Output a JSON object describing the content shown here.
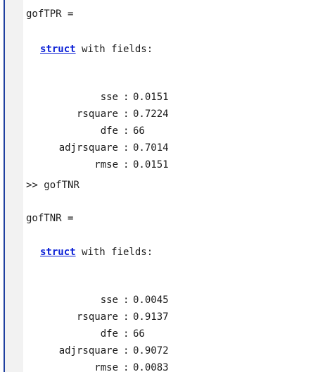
{
  "console": {
    "block1": {
      "var_header": "gofTPR =",
      "struct_keyword": "struct",
      "struct_suffix": " with fields:",
      "fields": [
        {
          "name": "sse",
          "value": "0.0151"
        },
        {
          "name": "rsquare",
          "value": "0.7224"
        },
        {
          "name": "dfe",
          "value": "66"
        },
        {
          "name": "adjrsquare",
          "value": "0.7014"
        },
        {
          "name": "rmse",
          "value": "0.0151"
        }
      ]
    },
    "command": {
      "prompt": ">>",
      "text": "gofTNR"
    },
    "block2": {
      "var_header": "gofTNR =",
      "struct_keyword": "struct",
      "struct_suffix": " with fields:",
      "fields": [
        {
          "name": "sse",
          "value": "0.0045"
        },
        {
          "name": "rsquare",
          "value": "0.9137"
        },
        {
          "name": "dfe",
          "value": "66"
        },
        {
          "name": "adjrsquare",
          "value": "0.9072"
        },
        {
          "name": "rmse",
          "value": "0.0083"
        }
      ]
    }
  },
  "colors": {
    "link": "#0a1fd6",
    "text": "#1a1a1a",
    "gutter_line": "#1f3f9f",
    "margin": "#f2f2f2"
  }
}
